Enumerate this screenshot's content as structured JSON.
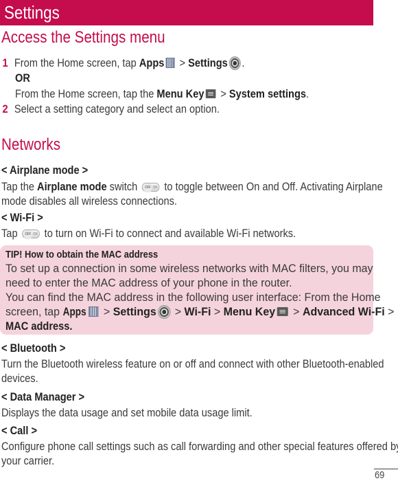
{
  "header": {
    "title": "Settings",
    "color": "#c50c4d"
  },
  "access_section": {
    "heading": "Access the Settings menu",
    "step1": {
      "number": "1",
      "text_a": "From the Home screen, tap ",
      "apps": "Apps",
      "sep1": " > ",
      "settings": "Settings",
      "end": ".",
      "or": "OR",
      "text_b": "From the Home screen, tap the ",
      "menu_key": "Menu Key",
      "sep2": " > ",
      "system_settings": "System settings",
      "end_b": "."
    },
    "step2": {
      "number": "2",
      "text": "Select a setting category and select an option."
    }
  },
  "networks": {
    "heading": "Networks",
    "airplane": {
      "title": "< Airplane mode >",
      "text_a": "Tap the ",
      "bold": "Airplane mode",
      "text_b": " switch ",
      "text_c": " to toggle between On and Off. Activating Airplane",
      "line2": "mode disables all wireless connections."
    },
    "wifi": {
      "title": "< Wi-Fi >",
      "text_a": "Tap ",
      "text_b": " to turn on Wi-Fi to connect and available Wi-Fi networks."
    },
    "toggle": {
      "off_label": "OFF",
      "on_label": "ON"
    },
    "tip": {
      "title": "TIP! How to obtain the MAC address",
      "line1": "To set up a connection in some wireless networks with MAC filters, you may",
      "line2": "need to enter the MAC address of your phone in the router.",
      "line3": "You can find the MAC address in the following user interface: From the Home",
      "line4_a": "screen, tap ",
      "apps": "Apps",
      "sep": " > ",
      "settings": "Settings",
      "wifi": "Wi-Fi",
      "menu_key": "Menu Key",
      "advanced": "Advanced Wi-Fi",
      "line5": "MAC address."
    },
    "bluetooth": {
      "title": "< Bluetooth >",
      "line1": "Turn the Bluetooth wireless feature on or off and connect with other Bluetooth-enabled",
      "line2": "devices."
    },
    "data_manager": {
      "title": "< Data Manager >",
      "line1": "Displays the data usage and set mobile data usage limit."
    },
    "call": {
      "title": "< Call >",
      "line1": "Configure phone call settings such as call forwarding and other special features offered by",
      "line2": "your carrier."
    }
  },
  "footer": {
    "page_number": "69"
  }
}
